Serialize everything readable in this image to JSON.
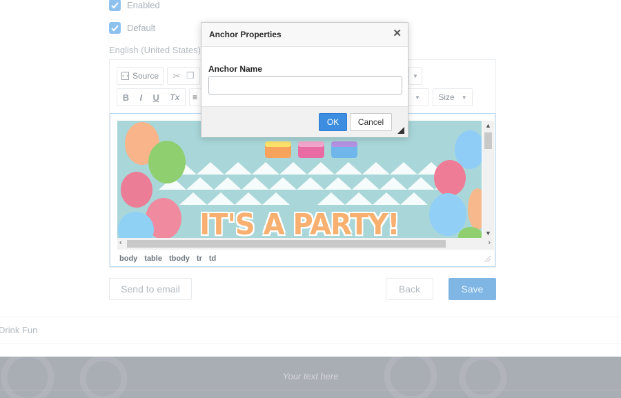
{
  "form": {
    "enabled_label": "Enabled",
    "default_label": "Default",
    "language_label": "English (United States)"
  },
  "toolbar": {
    "source_label": "Source",
    "bold_glyph": "B",
    "italic_glyph": "I",
    "underline_glyph": "U",
    "clear_format_glyph": "Tx",
    "size_label": "Size"
  },
  "editor": {
    "banner_text": "IT'S A PARTY!",
    "element_path": [
      "body",
      "table",
      "tbody",
      "tr",
      "td"
    ]
  },
  "actions": {
    "send_email_label": "Send to email",
    "back_label": "Back",
    "save_label": "Save"
  },
  "page": {
    "section_label": "Drink Fun",
    "footer_text": "Your text here"
  },
  "dialog": {
    "title": "Anchor Properties",
    "close_glyph": "✕",
    "field_label": "Anchor Name",
    "field_value": "",
    "ok_label": "OK",
    "cancel_label": "Cancel"
  },
  "colors": {
    "checkbox": "#8ec2ee",
    "save_button": "#7fb6e4",
    "ok_button": "#3d8ee0",
    "footer": "#a9adb4",
    "banner_bg": "#a9d7d9"
  }
}
